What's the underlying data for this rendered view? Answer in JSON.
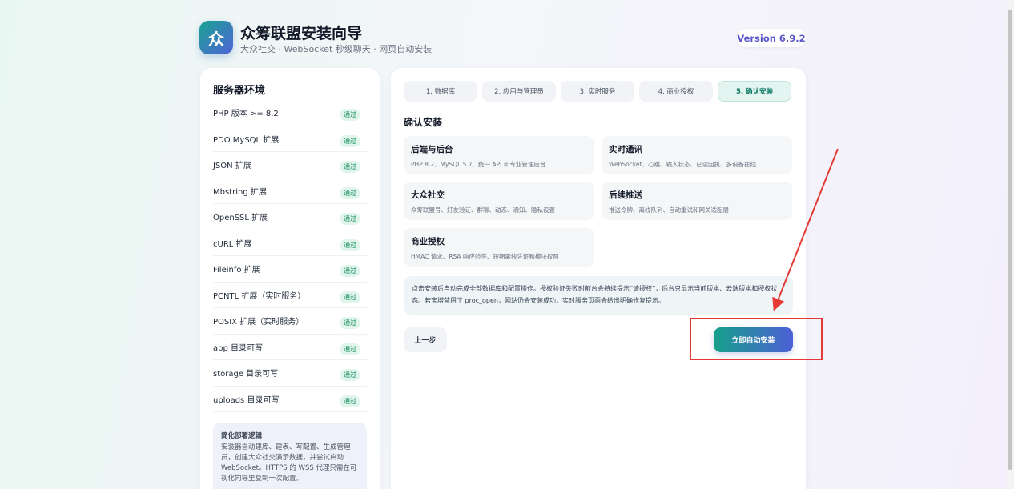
{
  "header": {
    "logo_char": "众",
    "title": "众筹联盟安装向导",
    "subtitle": "大众社交 · WebSocket 秒级聊天 · 网页自动安装",
    "version": "Version 6.9.2"
  },
  "environment": {
    "title": "服务器环境",
    "checks": [
      {
        "label": "PHP 版本 >= 8.2",
        "status": "通过"
      },
      {
        "label": "PDO MySQL 扩展",
        "status": "通过"
      },
      {
        "label": "JSON 扩展",
        "status": "通过"
      },
      {
        "label": "Mbstring 扩展",
        "status": "通过"
      },
      {
        "label": "OpenSSL 扩展",
        "status": "通过"
      },
      {
        "label": "cURL 扩展",
        "status": "通过"
      },
      {
        "label": "Fileinfo 扩展",
        "status": "通过"
      },
      {
        "label": "PCNTL 扩展（实时服务）",
        "status": "通过"
      },
      {
        "label": "POSIX 扩展（实时服务）",
        "status": "通过"
      },
      {
        "label": "app 目录可写",
        "status": "通过"
      },
      {
        "label": "storage 目录可写",
        "status": "通过"
      },
      {
        "label": "uploads 目录可写",
        "status": "通过"
      }
    ],
    "note": {
      "title": "简化部署逻辑",
      "text": "安装器自动建库、建表、写配置、生成管理员，创建大众社交演示数据，并尝试启动 WebSocket。HTTPS 的 WSS 代理只需在可视化向导里复制一次配置。"
    }
  },
  "steps": [
    {
      "label": "1. 数据库"
    },
    {
      "label": "2. 应用与管理员"
    },
    {
      "label": "3. 实时服务"
    },
    {
      "label": "4. 商业授权"
    },
    {
      "label": "5. 确认安装"
    }
  ],
  "active_step": 5,
  "confirm": {
    "title": "确认安装",
    "cards": [
      {
        "title": "后端与后台",
        "desc": "PHP 8.2、MySQL 5.7、统一 API 和专业管理后台"
      },
      {
        "title": "实时通讯",
        "desc": "WebSocket、心跳、输入状态、已读回执、多设备在线"
      },
      {
        "title": "大众社交",
        "desc": "众筹联盟号、好友验证、群聊、动态、通知、隐私设置"
      },
      {
        "title": "后续推送",
        "desc": "推送令牌、离线队列、自动重试和网关适配层"
      },
      {
        "title": "商业授权",
        "desc": "HMAC 请求、RSA 响应验签、短期离线凭证和模块权限"
      }
    ],
    "info": "点击安装后自动完成全部数据库和配置操作。授权验证失败时前台会持续提示“请授权”，后台只显示当前版本、云端版本和授权状态。若宝塔禁用了 proc_open，网站仍会安装成功，实时服务页面会给出明确修复提示。",
    "prev_label": "上一步",
    "install_label": "立即自动安装"
  },
  "colors": {
    "accent_start": "#16a08a",
    "accent_end": "#4d5fd6",
    "badge_green": "#0f8a5f",
    "annotation_red": "#e53935"
  }
}
